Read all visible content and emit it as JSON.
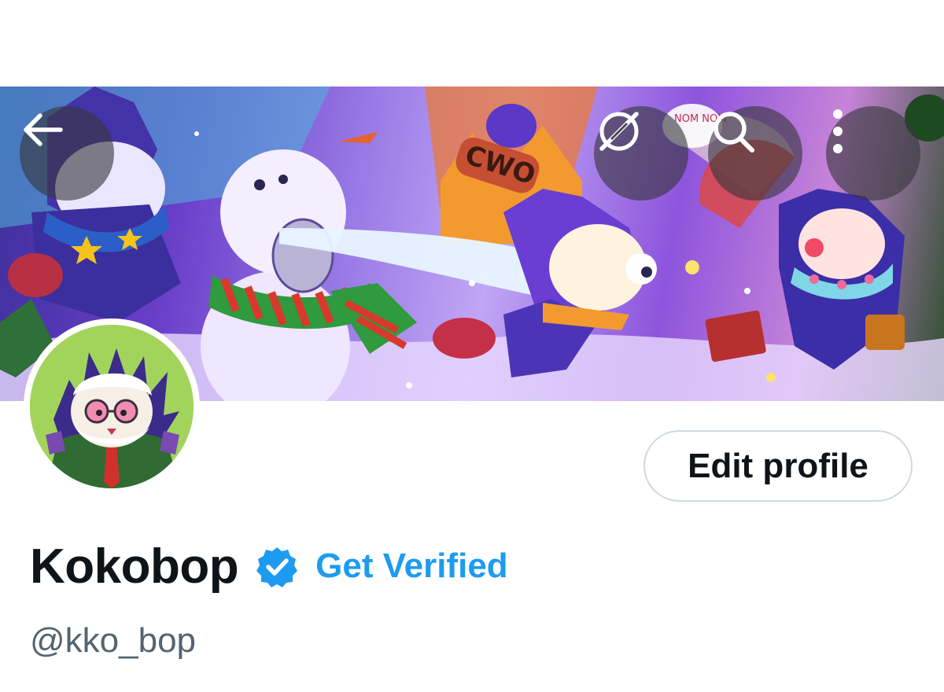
{
  "header": {
    "back_icon": "arrow-left-icon",
    "grok_icon": "grok-icon",
    "search_icon": "search-icon",
    "more_icon": "more-vertical-icon"
  },
  "banner": {
    "signs": [
      "CWO",
      "NOM NOM"
    ]
  },
  "profile": {
    "name": "Kokobop",
    "handle": "@kko_bop",
    "verified": true,
    "get_verified_label": "Get Verified",
    "edit_profile_label": "Edit profile"
  },
  "colors": {
    "accent": "#1d9bf0",
    "text_primary": "#0f1419",
    "text_secondary": "#536471",
    "button_border": "#cfd9de"
  }
}
